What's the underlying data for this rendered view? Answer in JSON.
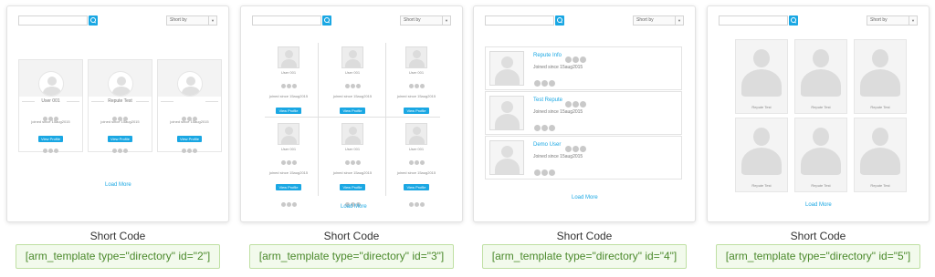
{
  "templates": [
    {
      "search": {
        "placeholder": "",
        "icon": "search-icon"
      },
      "sort": {
        "label": "Short by"
      },
      "members": [
        {
          "name": "User 001",
          "joined": "joined since 15aug2015",
          "button": "View Profile"
        },
        {
          "name": "Repute Test",
          "joined": "joined since 15aug2015",
          "button": "View Profile"
        },
        {
          "name": "",
          "joined": "joined since 15aug2015",
          "button": "View Profile"
        }
      ],
      "load_more": "Load More",
      "caption": "Short Code",
      "shortcode": "[arm_template type=\"directory\" id=\"2\"]"
    },
    {
      "search": {
        "placeholder": "",
        "icon": "search-icon"
      },
      "sort": {
        "label": "Short by"
      },
      "members": [
        {
          "name": "User 001",
          "joined": "joined since 15aug2015",
          "button": "View Profile"
        },
        {
          "name": "User 001",
          "joined": "joined since 15aug2015",
          "button": "View Profile"
        },
        {
          "name": "User 001",
          "joined": "joined since 15aug2015",
          "button": "View Profile"
        },
        {
          "name": "User 001",
          "joined": "joined since 15aug2015",
          "button": "View Profile"
        },
        {
          "name": "User 001",
          "joined": "joined since 15aug2015",
          "button": "View Profile"
        },
        {
          "name": "User 001",
          "joined": "joined since 15aug2015",
          "button": "View Profile"
        }
      ],
      "load_more": "Load More",
      "caption": "Short Code",
      "shortcode": "[arm_template type=\"directory\" id=\"3\"]"
    },
    {
      "search": {
        "placeholder": "",
        "icon": "search-icon"
      },
      "sort": {
        "label": "Short by"
      },
      "members": [
        {
          "name": "Repute Info",
          "joined": "Joined since 15aug2015"
        },
        {
          "name": "Test Repute",
          "joined": "Joined since 15aug2015"
        },
        {
          "name": "Demo User",
          "joined": "Joined since 15aug2015"
        }
      ],
      "load_more": "Load More",
      "caption": "Short Code",
      "shortcode": "[arm_template type=\"directory\" id=\"4\"]"
    },
    {
      "search": {
        "placeholder": "",
        "icon": "search-icon"
      },
      "sort": {
        "label": "Short by"
      },
      "members": [
        {
          "name": "Repute Test"
        },
        {
          "name": "Repute Test"
        },
        {
          "name": "Repute Test"
        },
        {
          "name": "Repute Test"
        },
        {
          "name": "Repute Test"
        },
        {
          "name": "Repute Test"
        }
      ],
      "load_more": "Load More",
      "caption": "Short Code",
      "shortcode": "[arm_template type=\"directory\" id=\"5\"]"
    }
  ],
  "colors": {
    "accent": "#1aa7e3",
    "code_text": "#4c8a2d",
    "code_bg": "#f2faec",
    "code_border": "#bfe0a3"
  }
}
